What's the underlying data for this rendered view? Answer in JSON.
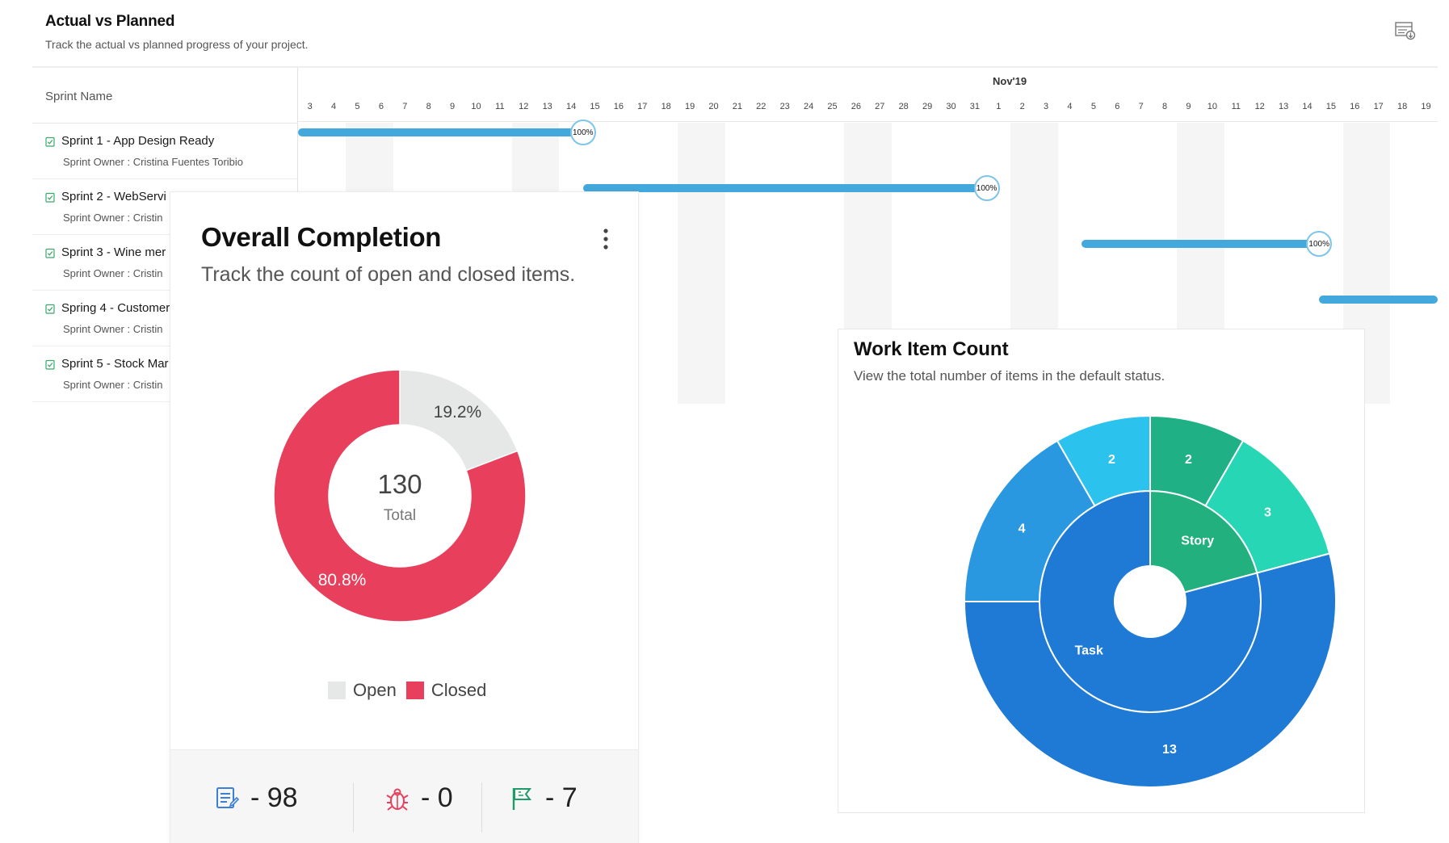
{
  "header": {
    "title": "Actual vs Planned",
    "subtitle": "Track the actual vs planned progress of your project."
  },
  "gantt": {
    "column_header": "Sprint Name",
    "month_label": "Nov'19",
    "days": [
      "3",
      "4",
      "5",
      "6",
      "7",
      "8",
      "9",
      "10",
      "11",
      "12",
      "13",
      "14",
      "15",
      "16",
      "17",
      "18",
      "19",
      "20",
      "21",
      "22",
      "23",
      "24",
      "25",
      "26",
      "27",
      "28",
      "29",
      "30",
      "31",
      "1",
      "2",
      "3",
      "4",
      "5",
      "6",
      "7",
      "8",
      "9",
      "10",
      "11",
      "12",
      "13",
      "14",
      "15",
      "16",
      "17",
      "18",
      "19"
    ],
    "weekend_day_indexes": [
      2,
      3,
      9,
      10,
      16,
      17,
      23,
      24,
      30,
      31,
      37,
      38,
      44,
      45
    ],
    "sprints": [
      {
        "name": "Sprint 1 - App Design Ready",
        "owner": "Sprint Owner : Cristina Fuentes Toribio",
        "bar_start_day_index": 0,
        "bar_end_day_index": 12,
        "progress_label": "100%",
        "progress": 1.0
      },
      {
        "name": "Sprint 2 - WebServi",
        "owner": "Sprint Owner : Cristin",
        "bar_start_day_index": 12,
        "bar_end_day_index": 29,
        "progress_label": "100%",
        "progress": 1.0
      },
      {
        "name": "Sprint 3 - Wine mer",
        "owner": "Sprint Owner : Cristin",
        "bar_start_day_index": 33,
        "bar_end_day_index": 43,
        "progress_label": "100%",
        "progress": 1.0
      },
      {
        "name": "Spring 4 - Customer",
        "owner": "Sprint Owner : Cristin",
        "bar_start_day_index": 43,
        "bar_end_day_index": 48,
        "progress_label": "",
        "progress": null
      },
      {
        "name": "Sprint 5 - Stock Mar",
        "owner": "Sprint Owner : Cristin",
        "bar_start_day_index": null,
        "bar_end_day_index": null,
        "progress_label": "",
        "progress": null
      }
    ]
  },
  "completion": {
    "title": "Overall Completion",
    "subtitle": "Track the count of open and closed items.",
    "total_value": "130",
    "total_label": "Total",
    "legend": [
      {
        "label": "Open",
        "color": "#e6e8e8"
      },
      {
        "label": "Closed",
        "color": "#e8405c"
      }
    ],
    "stats": [
      {
        "icon": "document-list-icon",
        "text": "- 98"
      },
      {
        "icon": "bug-icon",
        "text": "- 0"
      },
      {
        "icon": "flag-icon",
        "text": "- 7"
      }
    ]
  },
  "workitem": {
    "title": "Work Item Count",
    "subtitle": "View the total number of items in the default status."
  },
  "chart_data": [
    {
      "type": "pie",
      "variant": "donut",
      "categories": [
        "Open",
        "Closed"
      ],
      "values": [
        19.2,
        80.8
      ],
      "labels": [
        "19.2%",
        "80.8%"
      ],
      "colors": [
        "#e6e8e8",
        "#e8405c"
      ],
      "center_text": [
        "130",
        "Total"
      ],
      "legend_position": "bottom"
    },
    {
      "type": "pie",
      "variant": "sunburst",
      "inner": [
        {
          "name": "Task",
          "value": 19,
          "color": "#1f7ad6"
        },
        {
          "name": "Story",
          "value": 5,
          "color": "#22b07f"
        }
      ],
      "outer": [
        {
          "parent": "Task",
          "value": 13,
          "color": "#1f7ad6"
        },
        {
          "parent": "Task",
          "value": 4,
          "color": "#2a98e0"
        },
        {
          "parent": "Task",
          "value": 2,
          "color": "#2cc2ee"
        },
        {
          "parent": "Story",
          "value": 2,
          "color": "#1fb085"
        },
        {
          "parent": "Story",
          "value": 3,
          "color": "#26d6b4"
        }
      ]
    }
  ]
}
